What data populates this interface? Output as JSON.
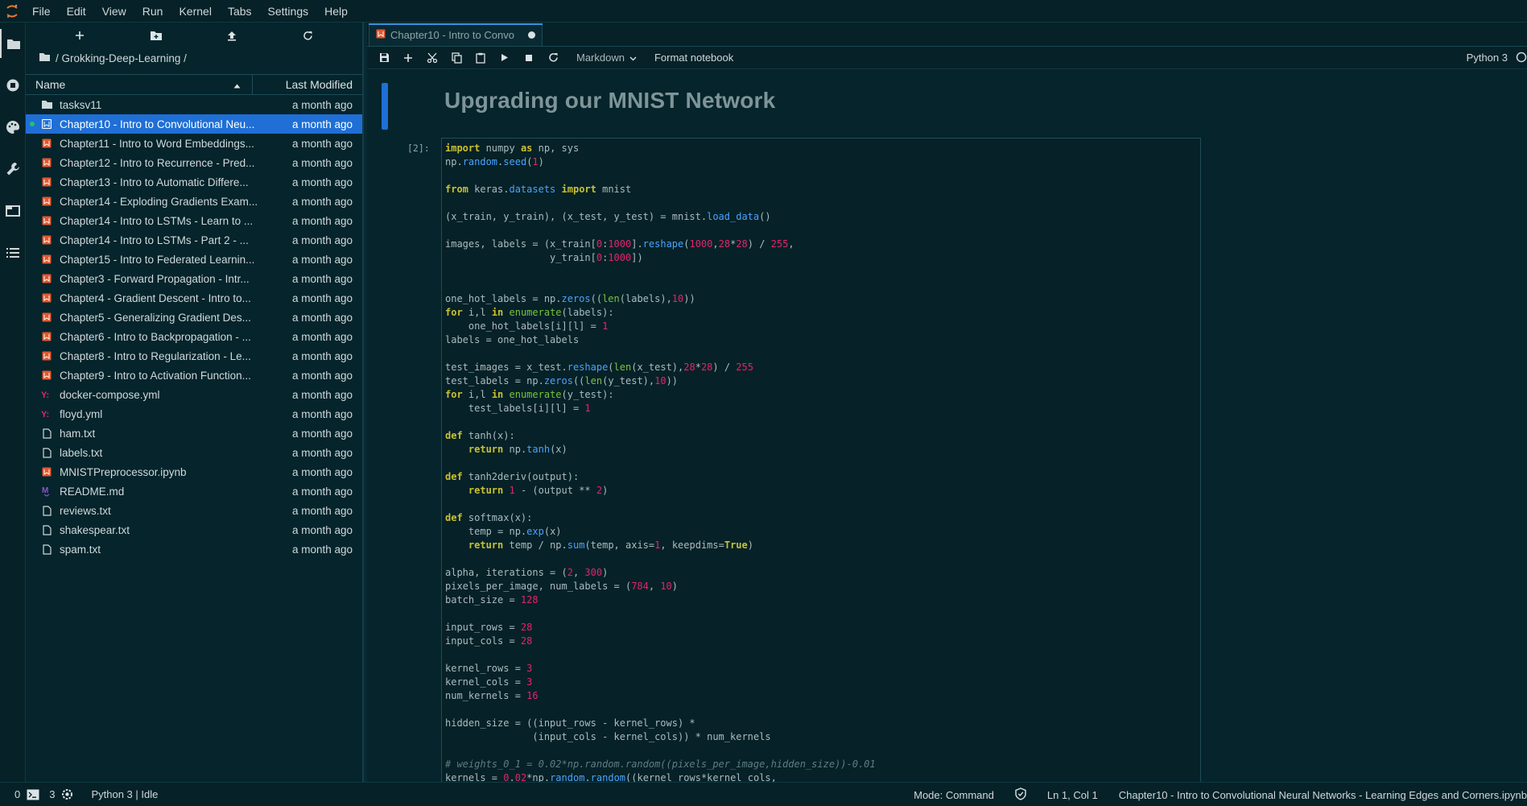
{
  "menubar": {
    "items": [
      "File",
      "Edit",
      "View",
      "Run",
      "Kernel",
      "Tabs",
      "Settings",
      "Help"
    ]
  },
  "activity": [
    "folder-icon",
    "running-icon",
    "palette-icon",
    "wrench-icon",
    "tabs-icon",
    "toc-icon"
  ],
  "filebrowser": {
    "breadcrumb": "/ Grokking-Deep-Learning /",
    "col_name": "Name",
    "col_modified": "Last Modified",
    "files": [
      {
        "name": "tasksv11",
        "type": "folder",
        "modified": "a month ago"
      },
      {
        "name": "Chapter10 - Intro to Convolutional Neu...",
        "type": "notebook",
        "modified": "a month ago",
        "selected": true,
        "running": true
      },
      {
        "name": "Chapter11 - Intro to Word Embeddings...",
        "type": "notebook",
        "modified": "a month ago"
      },
      {
        "name": "Chapter12 - Intro to Recurrence - Pred...",
        "type": "notebook",
        "modified": "a month ago"
      },
      {
        "name": "Chapter13 - Intro to Automatic Differe...",
        "type": "notebook",
        "modified": "a month ago"
      },
      {
        "name": "Chapter14 - Exploding Gradients Exam...",
        "type": "notebook",
        "modified": "a month ago"
      },
      {
        "name": "Chapter14 - Intro to LSTMs - Learn to ...",
        "type": "notebook",
        "modified": "a month ago"
      },
      {
        "name": "Chapter14 - Intro to LSTMs - Part 2 - ...",
        "type": "notebook",
        "modified": "a month ago"
      },
      {
        "name": "Chapter15 - Intro to Federated Learnin...",
        "type": "notebook",
        "modified": "a month ago"
      },
      {
        "name": "Chapter3 - Forward Propagation - Intr...",
        "type": "notebook",
        "modified": "a month ago"
      },
      {
        "name": "Chapter4 - Gradient Descent - Intro to...",
        "type": "notebook",
        "modified": "a month ago"
      },
      {
        "name": "Chapter5 - Generalizing Gradient Des...",
        "type": "notebook",
        "modified": "a month ago"
      },
      {
        "name": "Chapter6 - Intro to Backpropagation - ...",
        "type": "notebook",
        "modified": "a month ago"
      },
      {
        "name": "Chapter8 - Intro to Regularization - Le...",
        "type": "notebook",
        "modified": "a month ago"
      },
      {
        "name": "Chapter9 - Intro to Activation Function...",
        "type": "notebook",
        "modified": "a month ago"
      },
      {
        "name": "docker-compose.yml",
        "type": "yaml",
        "modified": "a month ago"
      },
      {
        "name": "floyd.yml",
        "type": "yaml",
        "modified": "a month ago"
      },
      {
        "name": "ham.txt",
        "type": "text",
        "modified": "a month ago"
      },
      {
        "name": "labels.txt",
        "type": "text",
        "modified": "a month ago"
      },
      {
        "name": "MNISTPreprocessor.ipynb",
        "type": "notebook",
        "modified": "a month ago"
      },
      {
        "name": "README.md",
        "type": "markdown",
        "modified": "a month ago"
      },
      {
        "name": "reviews.txt",
        "type": "text",
        "modified": "a month ago"
      },
      {
        "name": "shakespear.txt",
        "type": "text",
        "modified": "a month ago"
      },
      {
        "name": "spam.txt",
        "type": "text",
        "modified": "a month ago"
      }
    ]
  },
  "tab": {
    "label": "Chapter10 - Intro to Convo"
  },
  "nb_toolbar": {
    "cell_type": "Markdown",
    "format_notebook": "Format notebook",
    "kernel": "Python 3"
  },
  "notebook": {
    "heading": "Upgrading our MNIST Network",
    "prompt": "[2]:",
    "code_lines": [
      "import numpy as np, sys",
      "np.random.seed(1)",
      "",
      "from keras.datasets import mnist",
      "",
      "(x_train, y_train), (x_test, y_test) = mnist.load_data()",
      "",
      "images, labels = (x_train[0:1000].reshape(1000,28*28) / 255,",
      "                  y_train[0:1000])",
      "",
      "",
      "one_hot_labels = np.zeros((len(labels),10))",
      "for i,l in enumerate(labels):",
      "    one_hot_labels[i][l] = 1",
      "labels = one_hot_labels",
      "",
      "test_images = x_test.reshape(len(x_test),28*28) / 255",
      "test_labels = np.zeros((len(y_test),10))",
      "for i,l in enumerate(y_test):",
      "    test_labels[i][l] = 1",
      "",
      "def tanh(x):",
      "    return np.tanh(x)",
      "",
      "def tanh2deriv(output):",
      "    return 1 - (output ** 2)",
      "",
      "def softmax(x):",
      "    temp = np.exp(x)",
      "    return temp / np.sum(temp, axis=1, keepdims=True)",
      "",
      "alpha, iterations = (2, 300)",
      "pixels_per_image, num_labels = (784, 10)",
      "batch_size = 128",
      "",
      "input_rows = 28",
      "input_cols = 28",
      "",
      "kernel_rows = 3",
      "kernel_cols = 3",
      "num_kernels = 16",
      "",
      "hidden_size = ((input_rows - kernel_rows) *",
      "               (input_cols - kernel_cols)) * num_kernels",
      "",
      "# weights_0_1 = 0.02*np.random.random((pixels_per_image,hidden_size))-0.01",
      "kernels = 0.02*np.random.random((kernel_rows*kernel_cols,"
    ]
  },
  "statusbar": {
    "terminals": "0",
    "kernels": "3",
    "kernel_status": "Python 3 | Idle",
    "mode": "Mode: Command",
    "cursor": "Ln 1, Col 1",
    "path": "Chapter10 - Intro to Convolutional Neural Networks - Learning Edges and Corners.ipynb"
  },
  "colors": {
    "accent": "#1f6fd6",
    "notebook_icon": "#e4572e",
    "yaml_icon": "#e2246c",
    "markdown_icon": "#8a56c8",
    "running": "#21c36b"
  }
}
